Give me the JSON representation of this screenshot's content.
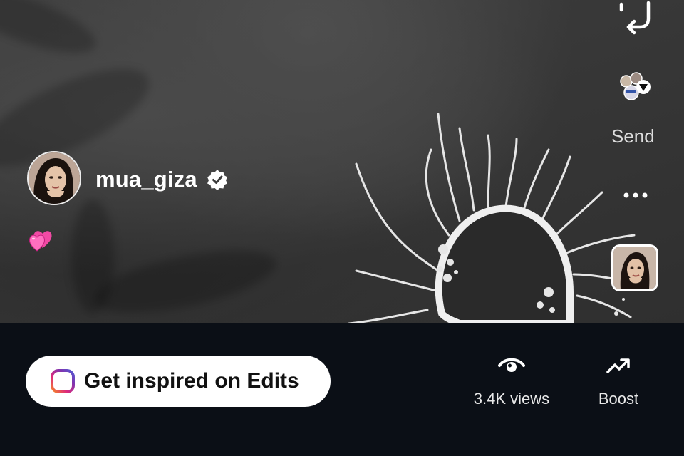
{
  "video": {
    "username": "mua_giza",
    "verified_badge": "verified-icon",
    "caption_emoji": "💕"
  },
  "side_actions": {
    "repost_icon": "repost-icon",
    "send_label": "Send",
    "more_icon": "more-dots-icon"
  },
  "bottom_bar": {
    "edits_button_label": "Get inspired on Edits",
    "views_label": "3.4K views",
    "boost_label": "Boost"
  },
  "colors": {
    "bottom_bar_bg": "#0b0f16",
    "edits_logo_gradient": [
      "#f58529",
      "#dd2a7b",
      "#8134af",
      "#515bd4"
    ]
  }
}
